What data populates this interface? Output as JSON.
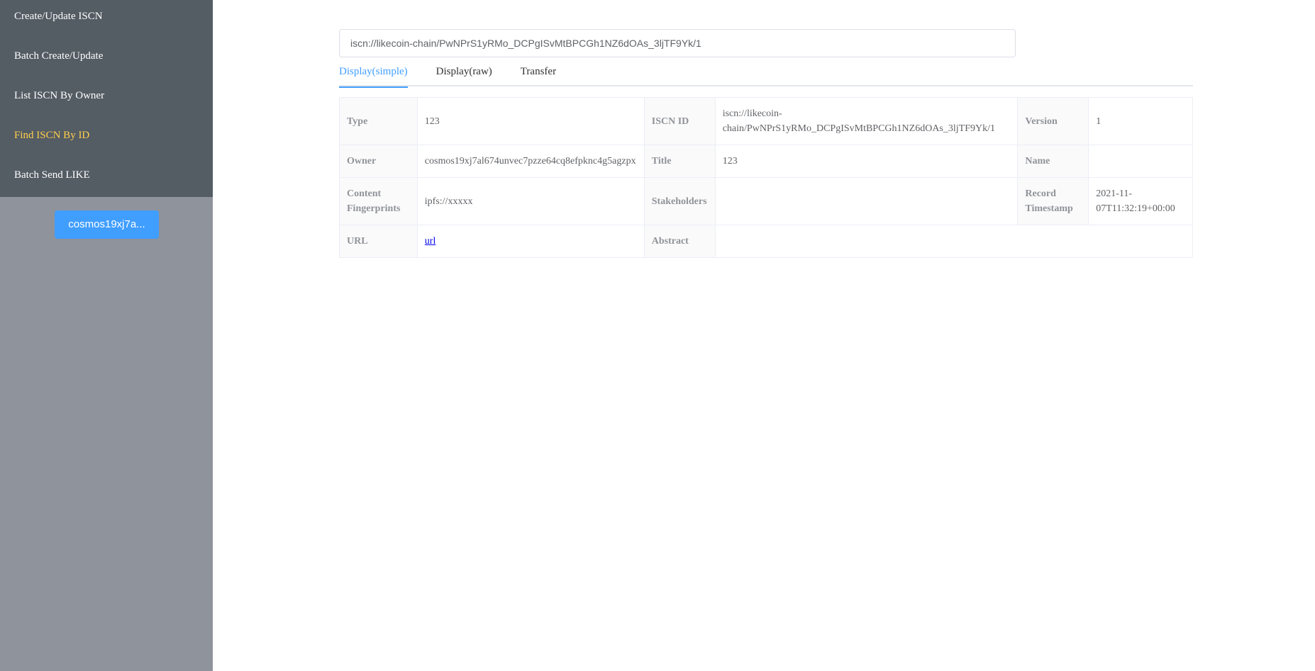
{
  "sidebar": {
    "items": [
      {
        "label": "Create/Update ISCN"
      },
      {
        "label": "Batch Create/Update"
      },
      {
        "label": "List ISCN By Owner"
      },
      {
        "label": "Find ISCN By ID"
      },
      {
        "label": "Batch Send LIKE"
      }
    ],
    "active_item": "Find ISCN By ID",
    "wallet_button": "cosmos19xj7a..."
  },
  "search": {
    "value": "iscn://likecoin-chain/PwNPrS1yRMo_DCPgISvMtBPCGh1NZ6dOAs_3ljTF9Yk/1"
  },
  "tabs": [
    {
      "label": "Display(simple)",
      "active": true
    },
    {
      "label": "Display(raw)",
      "active": false
    },
    {
      "label": "Transfer",
      "active": false
    }
  ],
  "record": {
    "type_label": "Type",
    "type_value": "123",
    "iscn_id_label": "ISCN ID",
    "iscn_id_value": "iscn://likecoin-chain/PwNPrS1yRMo_DCPgISvMtBPCGh1NZ6dOAs_3ljTF9Yk/1",
    "version_label": "Version",
    "version_value": "1",
    "owner_label": "Owner",
    "owner_value": "cosmos19xj7al674unvec7pzze64cq8efpknc4g5agzpx",
    "title_label": "Title",
    "title_value": "123",
    "name_label": "Name",
    "name_value": "",
    "fingerprints_label": "Content Fingerprints",
    "fingerprints_value": "ipfs://xxxxx",
    "stakeholders_label": "Stakeholders",
    "stakeholders_value": "",
    "timestamp_label": "Record Timestamp",
    "timestamp_value": "2021-11-07T11:32:19+00:00",
    "url_label": "URL",
    "url_value": "url",
    "abstract_label": "Abstract",
    "abstract_value": ""
  },
  "colors": {
    "sidebar_menu_bg": "#545c64",
    "sidebar_bg": "#8f939c",
    "active_menu": "#ffd04b",
    "accent": "#409eff"
  }
}
